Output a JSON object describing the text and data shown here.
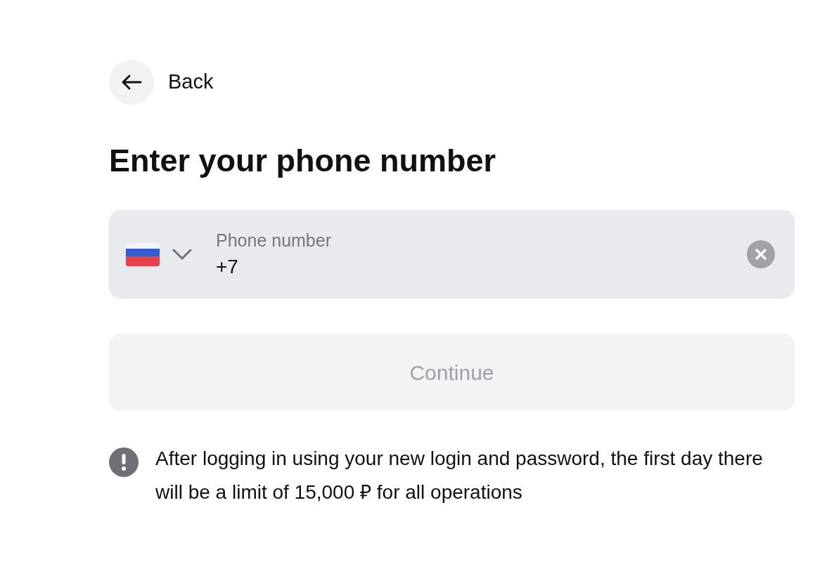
{
  "back_button": {
    "label": "Back"
  },
  "title": "Enter your phone number",
  "phone_field": {
    "label": "Phone number",
    "value": "+7"
  },
  "continue_button": {
    "label": "Continue",
    "disabled": true
  },
  "notice": "After logging in using your new login and password, the first day there will be a limit of 15,000 ₽ for all operations"
}
